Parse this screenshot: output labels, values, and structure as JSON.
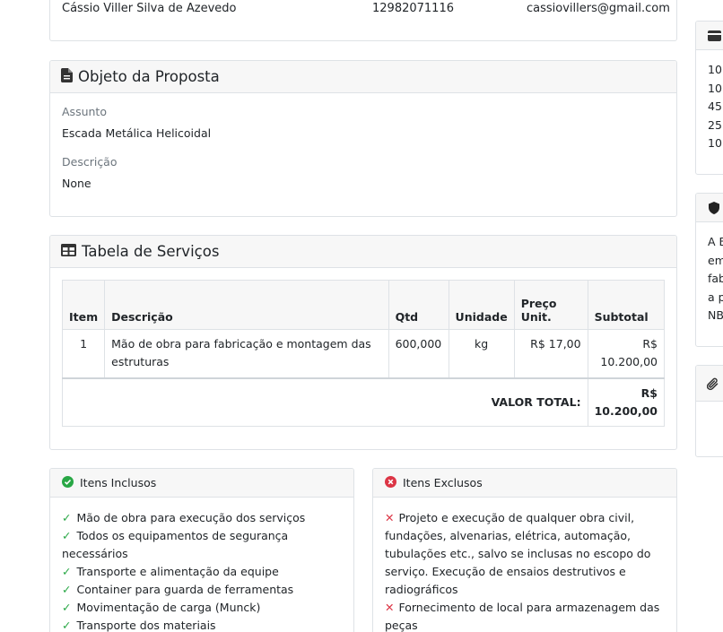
{
  "contact": {
    "name": "Cássio Viller Silva de Azevedo",
    "phone": "12982071116",
    "email": "cassiovillers@gmail.com"
  },
  "objeto": {
    "title": "Objeto da Proposta",
    "subject_label": "Assunto",
    "subject_value": "Escada Metálica Helicoidal",
    "description_label": "Descrição",
    "description_value": "None"
  },
  "tabela": {
    "title": "Tabela de Serviços",
    "headers": {
      "item": "Item",
      "descricao": "Descrição",
      "qtd": "Qtd",
      "unidade": "Unidade",
      "preco_1": "Preço",
      "preco_2": "Unit.",
      "subtotal": "Subtotal"
    },
    "rows": [
      {
        "item": "1",
        "descricao": "Mão de obra para fabricação e montagem das estruturas",
        "qtd": "600,000",
        "unidade": "kg",
        "preco": "R$ 17,00",
        "subtotal_1": "R$",
        "subtotal_2": "10.200,00"
      }
    ],
    "total_label": "VALOR TOTAL:",
    "total_1": "R$",
    "total_2": "10.200,00"
  },
  "inclusos": {
    "title": "Itens Inclusos",
    "items": [
      "Mão de obra para execução dos serviços",
      "Todos os equipamentos de segurança necessários",
      "Transporte e alimentação da equipe",
      "Container para guarda de ferramentas",
      "Movimentação de carga (Munck)",
      "Transporte dos materiais"
    ]
  },
  "exclusos": {
    "title": "Itens Exclusos",
    "items": [
      "Projeto e execução de qualquer obra civil, fundações, alvenarias, elétrica, automação, tubulações etc., salvo se inclusas no escopo do serviço. Execução de ensaios destrutivos e radiográficos",
      "Fornecimento de local para armazenagem das peças"
    ]
  },
  "sidebar": {
    "payment_lines": [
      "10",
      "10",
      "45",
      "25",
      "10"
    ],
    "warranty_lines": [
      "A E",
      "em",
      "fab",
      "a p",
      "NB"
    ]
  },
  "colors": {
    "check": "#28a745",
    "cross": "#dc3545",
    "header_bg": "#f7f7f7"
  },
  "icons": [
    "file-icon",
    "table-icon",
    "check-circle-icon",
    "times-circle-icon",
    "credit-card-icon",
    "shield-icon",
    "paperclip-icon"
  ]
}
